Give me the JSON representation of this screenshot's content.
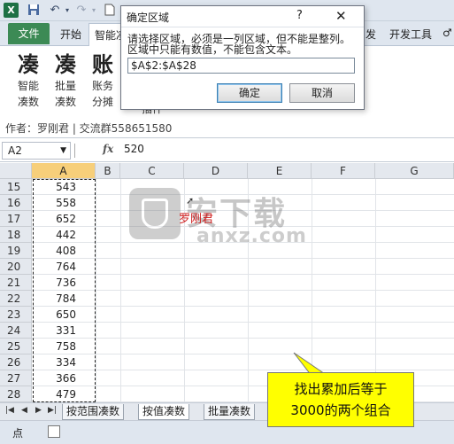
{
  "quick_access": {
    "excel_icon": "X",
    "save_icon": "save-icon",
    "undo_icon": "undo-icon",
    "redo_icon": "redo-icon"
  },
  "ribbon_tabs": {
    "file": "文件",
    "home": "开始",
    "addin_partial": "智能凑",
    "dev_partial": "发",
    "developer": "开发工具",
    "help_partial": "♂"
  },
  "ribbon": {
    "buttons": [
      {
        "glyph": "凑",
        "label1": "智能",
        "label2": "凑数"
      },
      {
        "glyph": "凑",
        "label1": "批量",
        "label2": "凑数"
      },
      {
        "glyph": "账",
        "label1": "账务",
        "label2": "分摊"
      }
    ],
    "partial_label": "插件",
    "author": "作者：罗刚君 | 交流群558651580"
  },
  "formula_bar": {
    "name_box": "A2",
    "fx": "fx",
    "value": "520"
  },
  "grid": {
    "columns": [
      "A",
      "B",
      "C",
      "D",
      "E",
      "F",
      "G"
    ],
    "rows": [
      {
        "row": "15",
        "value": "543"
      },
      {
        "row": "16",
        "value": "558"
      },
      {
        "row": "17",
        "value": "652"
      },
      {
        "row": "18",
        "value": "442"
      },
      {
        "row": "19",
        "value": "408"
      },
      {
        "row": "20",
        "value": "764"
      },
      {
        "row": "21",
        "value": "736"
      },
      {
        "row": "22",
        "value": "784"
      },
      {
        "row": "23",
        "value": "650"
      },
      {
        "row": "24",
        "value": "331"
      },
      {
        "row": "25",
        "value": "758"
      },
      {
        "row": "26",
        "value": "334"
      },
      {
        "row": "27",
        "value": "366"
      },
      {
        "row": "28",
        "value": "479"
      }
    ],
    "red_text": "罗刚君"
  },
  "watermark": {
    "main": "安下载",
    "sub": "anxz.com"
  },
  "callout": {
    "line1": "找出累加后等于",
    "line2": "3000的两个组合"
  },
  "sheet_tabs": [
    "按范围凑数",
    "按值凑数",
    "批量凑数"
  ],
  "status": {
    "mode": "点"
  },
  "dialog": {
    "title": "确定区域",
    "help": "?",
    "close": "✕",
    "message1": "请选择区域，必须是一列区域，但不能是整列。",
    "message2": "区域中只能有数值，不能包含文本。",
    "input_value": "$A$2:$A$28",
    "ok": "确定",
    "cancel": "取消"
  }
}
